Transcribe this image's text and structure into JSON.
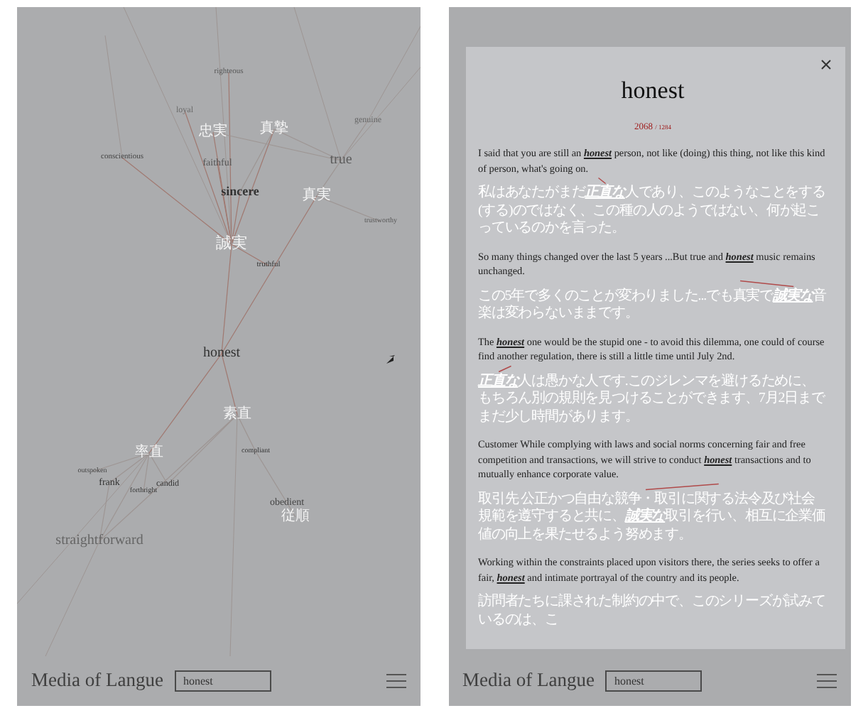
{
  "graph_screen": {
    "nodes": [
      {
        "text": "righteous",
        "kind": "en"
      },
      {
        "text": "loyal",
        "kind": "en"
      },
      {
        "text": "忠実",
        "kind": "ja"
      },
      {
        "text": "真摯",
        "kind": "ja"
      },
      {
        "text": "conscientious",
        "kind": "en"
      },
      {
        "text": "faithful",
        "kind": "en"
      },
      {
        "text": "genuine",
        "kind": "en"
      },
      {
        "text": "true",
        "kind": "en"
      },
      {
        "text": "sincere",
        "kind": "en"
      },
      {
        "text": "真実",
        "kind": "ja"
      },
      {
        "text": "trustworthy",
        "kind": "en"
      },
      {
        "text": "誠実",
        "kind": "ja"
      },
      {
        "text": "truthful",
        "kind": "en"
      },
      {
        "text": "honest",
        "kind": "en"
      },
      {
        "text": "素直",
        "kind": "ja"
      },
      {
        "text": "率直",
        "kind": "ja"
      },
      {
        "text": "compliant",
        "kind": "en"
      },
      {
        "text": "outspoken",
        "kind": "en"
      },
      {
        "text": "frank",
        "kind": "en"
      },
      {
        "text": "forthright",
        "kind": "en"
      },
      {
        "text": "candid",
        "kind": "en"
      },
      {
        "text": "obedient",
        "kind": "en"
      },
      {
        "text": "従順",
        "kind": "ja"
      },
      {
        "text": "straightforward",
        "kind": "en"
      }
    ],
    "bottom_bar": {
      "app_title": "Media of Langue",
      "search": {
        "value": "honest"
      }
    }
  },
  "detail_screen": {
    "modal": {
      "title": "honest",
      "count": "2068",
      "total": "/ 1284",
      "examples": [
        {
          "english": "I said that you are still an **honest** person, not like (doing) this thing, not like this kind of person, what's going on.",
          "japanese": "私はあなたがまだ**正直な**人であり、このようなことをする(する)のではなく、この種の人のようではない、何が起こっているのかを言った。"
        },
        {
          "english": "So many things changed over the last 5 years ...But true and **honest** music remains unchanged.",
          "japanese": "この5年で多くのことが変わりました...でも真実で**誠実な**音楽は変わらないままです。"
        },
        {
          "english": "The **honest** one would be the stupid one - to avoid this dilemma, one could of course find another regulation, there is still a little time until July 2nd.",
          "japanese": "**正直な**人は愚かな人です.このジレンマを避けるために、もちろん別の規則を見つけることができます、7月2日までまだ少し時間があります。"
        },
        {
          "english": "Customer While complying with laws and social norms concerning fair and free competition and transactions, we will strive to conduct **honest** transactions and to mutually enhance corporate value.",
          "japanese": "取引先 公正かつ自由な競争・取引に関する法令及び社会規範を遵守すると共に、**誠実な**取引を行い、相互に企業価値の向上を果たせるよう努めます。"
        },
        {
          "english": "Working within the constraints placed upon visitors there, the series seeks to offer a fair, **honest** and intimate portrayal of the country and its people.",
          "japanese": "訪問者たちに課された制約の中で、このシリーズが試みているのは、こ"
        }
      ]
    },
    "bottom_bar": {
      "app_title": "Media of Langue",
      "search": {
        "value": "honest"
      }
    }
  }
}
